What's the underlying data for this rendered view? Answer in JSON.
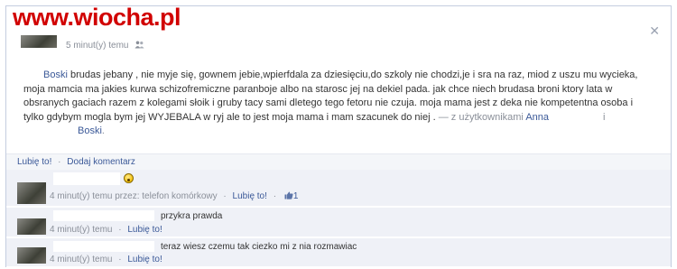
{
  "watermark": "www.wiocha.pl",
  "post": {
    "time": "5 minut(y) temu",
    "body_name": "Boski",
    "body_text": " brudas jebany , nie myje się, gownem jebie,wpierfdala za dziesięciu,do szkoly nie chodzi,je i sra na raz, miod z uszu mu wycieka, moja mamcia ma jakies kurwa schizofremiczne paranboje albo na starosc jej na dekiel pada. jak chce niech brudasa broni ktory lata w obsranych gaciach razem z kolegami słoik i gruby tacy sami dletego tego fetoru nie czuja. moja mama jest z deka nie kompetentna osoba i tylko gdybym mogla bym jej WYJEBALA w ryj ale to jest moja mama i mam szacunek do niej .",
    "tag_prefix": " — z użytkownikami ",
    "tag_name_1": "Anna",
    "tag_i": "i",
    "tag_name_2": "Boski",
    "tag_suffix": "."
  },
  "actions": {
    "like": "Lubię to!",
    "comment": "Dodaj komentarz"
  },
  "comments": [
    {
      "text": "",
      "time": "4 minut(y) temu przez: telefon komórkowy",
      "like": "Lubię to!",
      "like_count": "1"
    },
    {
      "text": "przykra prawda",
      "time": "4 minut(y) temu",
      "like": "Lubię to!"
    },
    {
      "text": "teraz wiesz czemu tak ciezko mi z nia rozmawiac",
      "time": "4 minut(y) temu",
      "like": "Lubię to!"
    }
  ],
  "separator": "·",
  "icons": {
    "close": "close-icon",
    "audience": "people-icon",
    "thumb": "thumbs-up-icon",
    "emoji": "surprised-emoji-icon"
  }
}
